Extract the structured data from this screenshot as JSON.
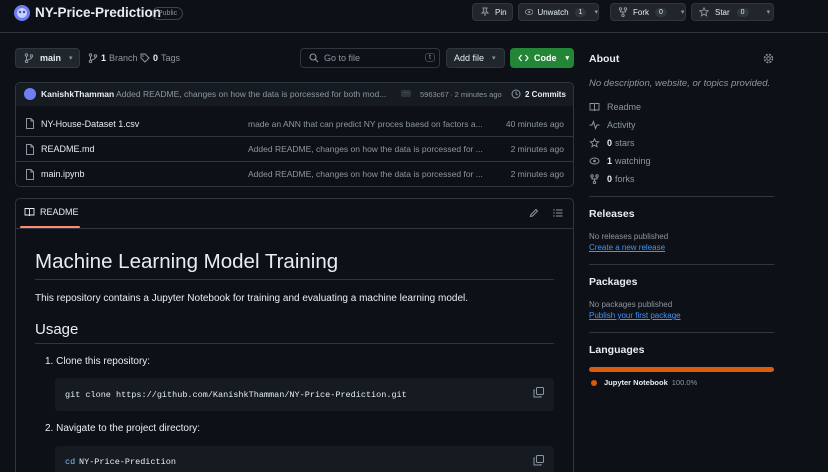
{
  "repo": {
    "name": "NY-Price-Prediction",
    "visibility": "Public"
  },
  "actions": {
    "pin": "Pin",
    "unwatch": "Unwatch",
    "unwatch_count": "1",
    "fork": "Fork",
    "fork_count": "0",
    "star": "Star",
    "star_count": "0"
  },
  "toolbar": {
    "branch": "main",
    "branch_count": "1",
    "branch_label": "Branch",
    "tag_count": "0",
    "tag_label": "Tags",
    "goto_placeholder": "Go to file",
    "goto_shortcut": "t",
    "add_file": "Add file",
    "code": "Code"
  },
  "commit": {
    "author": "KanishkThamman",
    "message": "Added README, changes on how the data is porcessed for both mod...",
    "hash": "5963c67",
    "time": "· 2 minutes ago",
    "commits": "2 Commits"
  },
  "files": [
    {
      "name": "NY-House-Dataset 1.csv",
      "message": "made an ANN that can predict NY proces baesd on factors a...",
      "time": "40 minutes ago"
    },
    {
      "name": "README.md",
      "message": "Added README, changes on how the data is porcessed for ...",
      "time": "2 minutes ago"
    },
    {
      "name": "main.ipynb",
      "message": "Added README, changes on how the data is porcessed for ...",
      "time": "2 minutes ago"
    }
  ],
  "readme": {
    "tab": "README",
    "h1": "Machine Learning Model Training",
    "intro": "This repository contains a Jupyter Notebook for training and evaluating a machine learning model.",
    "h2": "Usage",
    "step1": "1. Clone this repository:",
    "code1": "git clone https://github.com/KanishkThamman/NY-Price-Prediction.git",
    "step2": "2. Navigate to the project directory:",
    "code2_cmd": "cd",
    "code2_arg": "NY-Price-Prediction"
  },
  "about": {
    "title": "About",
    "description": "No description, website, or topics provided.",
    "readme": "Readme",
    "activity": "Activity",
    "stars_count": "0",
    "stars_label": "stars",
    "watching_count": "1",
    "watching_label": "watching",
    "forks_count": "0",
    "forks_label": "forks"
  },
  "releases": {
    "title": "Releases",
    "none": "No releases published",
    "create": "Create a new release"
  },
  "packages": {
    "title": "Packages",
    "none": "No packages published",
    "publish": "Publish your first package"
  },
  "languages": {
    "title": "Languages",
    "items": [
      {
        "name": "Jupyter Notebook",
        "percent": "100.0%",
        "color": "#DA5B0B"
      }
    ]
  },
  "colors": {
    "accent_green": "#238636",
    "link": "#4493f8",
    "readme_underline": "#fd8c73"
  }
}
